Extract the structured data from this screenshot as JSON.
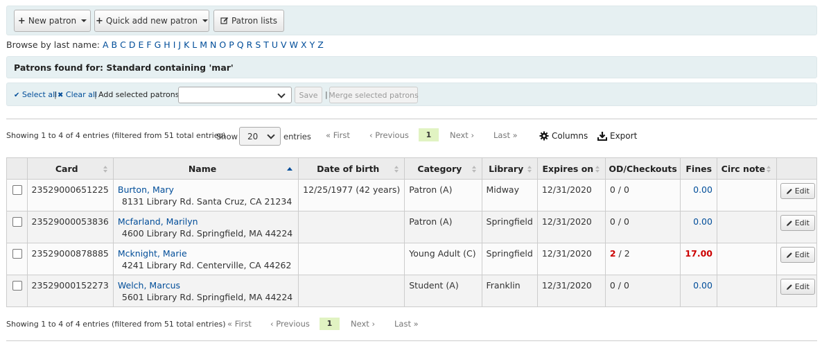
{
  "toolbar": {
    "new_patron": "New patron",
    "quick_add": "Quick add new patron",
    "patron_lists": "Patron lists"
  },
  "browse": {
    "label": "Browse by last name:",
    "letters": [
      "A",
      "B",
      "C",
      "D",
      "E",
      "F",
      "G",
      "H",
      "I",
      "J",
      "K",
      "L",
      "M",
      "N",
      "O",
      "P",
      "Q",
      "R",
      "S",
      "T",
      "U",
      "V",
      "W",
      "X",
      "Y",
      "Z"
    ]
  },
  "results_header": "Patrons found for: Standard containing 'mar'",
  "selection": {
    "select_all": "Select all",
    "clear_all": "Clear all",
    "add_label": "Add selected patrons to:",
    "list_value": "",
    "save": "Save",
    "merge": "Merge selected patrons"
  },
  "listing": {
    "info": "Showing 1 to 4 of 4 entries (filtered from 51 total entries)",
    "show_label": "Show",
    "page_length": "20",
    "entries_label": "entries",
    "first": "First",
    "previous": "Previous",
    "current_page": "1",
    "next": "Next",
    "last": "Last",
    "columns": "Columns",
    "export": "Export"
  },
  "table": {
    "columns": [
      "Card",
      "Name",
      "Date of birth",
      "Category",
      "Library",
      "Expires on",
      "OD/Checkouts",
      "Fines",
      "Circ note",
      ""
    ],
    "edit_label": "Edit",
    "rows": [
      {
        "card": "23529000651225",
        "name": "Burton, Mary",
        "address": "8131 Library Rd.  Santa Cruz, CA 21234",
        "dob": "12/25/1977 (42 years)",
        "category": "Patron (A)",
        "library": "Midway",
        "expires": "12/31/2020",
        "od": "0",
        "checkouts": "0",
        "fines": "0.00",
        "circ_note": ""
      },
      {
        "card": "23529000053836",
        "name": "Mcfarland, Marilyn",
        "address": "4600 Library Rd.  Springfield, MA 44224",
        "dob": "",
        "category": "Patron (A)",
        "library": "Springfield",
        "expires": "12/31/2020",
        "od": "0",
        "checkouts": "0",
        "fines": "0.00",
        "circ_note": ""
      },
      {
        "card": "23529000878885",
        "name": "Mcknight, Marie",
        "address": "4241 Library Rd.  Centerville, CA 44262",
        "dob": "",
        "category": "Young Adult (C)",
        "library": "Springfield",
        "expires": "12/31/2020",
        "od": "2",
        "checkouts": "2",
        "fines": "17.00",
        "circ_note": ""
      },
      {
        "card": "23529000152273",
        "name": "Welch, Marcus",
        "address": "5601 Library Rd.  Springfield, MA 44224",
        "dob": "",
        "category": "Student (A)",
        "library": "Franklin",
        "expires": "12/31/2020",
        "od": "0",
        "checkouts": "0",
        "fines": "0.00",
        "circ_note": ""
      }
    ]
  },
  "colors": {
    "toolbar_bg": "#e6f0f2",
    "link": "#004d99",
    "current_page_bg": "#e1f3c2",
    "alert": "#cc0000"
  }
}
